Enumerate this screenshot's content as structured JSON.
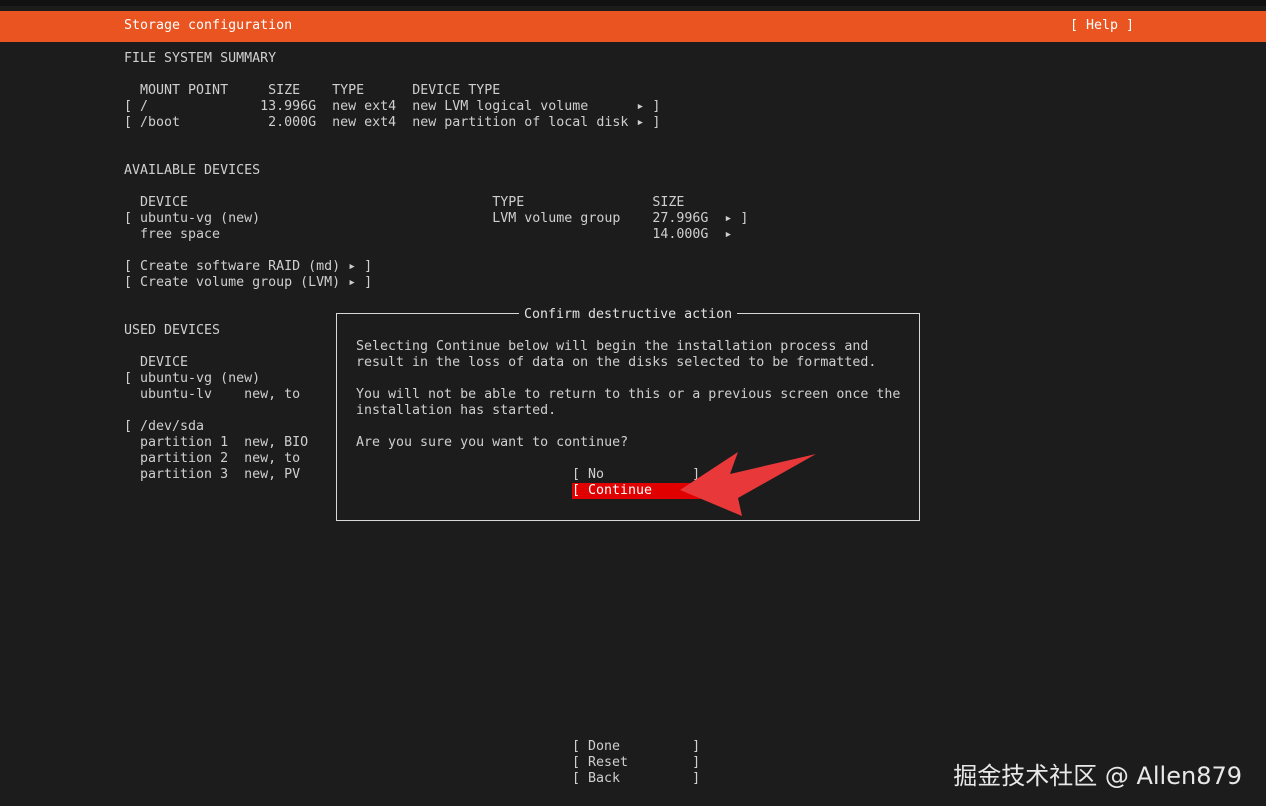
{
  "header": {
    "title": "Storage configuration",
    "help": "[ Help ]"
  },
  "fs_summary": {
    "heading": "FILE SYSTEM SUMMARY",
    "columns": "  MOUNT POINT     SIZE    TYPE      DEVICE TYPE",
    "rows": [
      "[ /              13.996G  new ext4  new LVM logical volume      ▸ ]",
      "[ /boot           2.000G  new ext4  new partition of local disk ▸ ]"
    ]
  },
  "available": {
    "heading": "AVAILABLE DEVICES",
    "columns": "  DEVICE                                      TYPE                SIZE",
    "rows": [
      "[ ubuntu-vg (new)                             LVM volume group    27.996G  ▸ ]",
      "  free space                                                      14.000G  ▸"
    ],
    "actions": [
      "[ Create software RAID (md) ▸ ]",
      "[ Create volume group (LVM) ▸ ]"
    ]
  },
  "used": {
    "heading": "USED DEVICES",
    "columns": "  DEVICE",
    "rows": [
      "[ ubuntu-vg (new)",
      "  ubuntu-lv    new, to",
      "",
      "[ /dev/sda",
      "  partition 1  new, BIO",
      "  partition 2  new, to",
      "  partition 3  new, PV"
    ]
  },
  "dialog": {
    "title": "Confirm destructive action",
    "lines": [
      "Selecting Continue below will begin the installation process and",
      "result in the loss of data on the disks selected to be formatted.",
      "",
      "You will not be able to return to this or a previous screen once the",
      "installation has started.",
      "",
      "Are you sure you want to continue?"
    ],
    "no_button": "[ No           ]",
    "continue_button": "[ Continue     ]"
  },
  "footer": {
    "done": "[ Done         ]",
    "reset": "[ Reset        ]",
    "back": "[ Back         ]"
  },
  "watermark": "掘金技术社区 @ Allen879",
  "colors": {
    "accent": "#e95420",
    "selected": "#e00000",
    "background": "#1c1c1c",
    "arrow": "#e8383a"
  }
}
